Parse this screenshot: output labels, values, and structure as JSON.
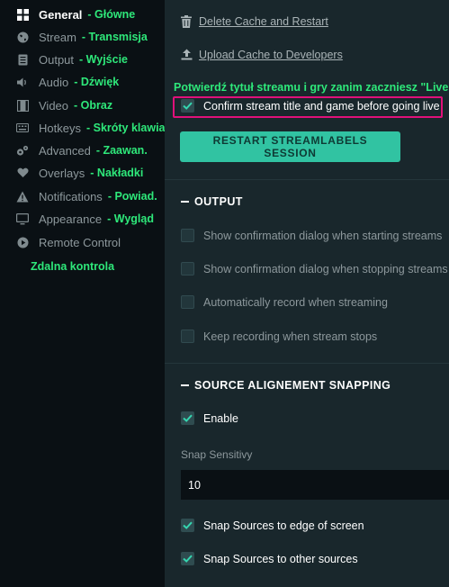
{
  "sidebar": {
    "items": [
      {
        "label": "General",
        "translation": "- Główne",
        "icon": "grid-icon",
        "active": true
      },
      {
        "label": "Stream",
        "translation": "- Transmisja",
        "icon": "globe-icon"
      },
      {
        "label": "Output",
        "translation": "- Wyjście",
        "icon": "file-icon"
      },
      {
        "label": "Audio",
        "translation": "- Dźwięk",
        "icon": "volume-icon"
      },
      {
        "label": "Video",
        "translation": "- Obraz",
        "icon": "film-icon"
      },
      {
        "label": "Hotkeys",
        "translation": "- Skróty klawiat",
        "icon": "keyboard-icon"
      },
      {
        "label": "Advanced",
        "translation": "- Zaawan.",
        "icon": "cogs-icon"
      },
      {
        "label": "Overlays",
        "translation": "- Nakładki",
        "icon": "heart-icon"
      },
      {
        "label": "Notifications",
        "translation": "- Powiad.",
        "icon": "warning-icon"
      },
      {
        "label": "Appearance",
        "translation": "- Wygląd",
        "icon": "monitor-icon"
      },
      {
        "label": "Remote Control",
        "translation": "",
        "icon": "play-circle-icon"
      }
    ],
    "remote_translation": "Zdalna kontrola"
  },
  "main": {
    "delete_cache_label": "Delete Cache and Restart",
    "upload_cache_label": "Upload Cache to Developers",
    "overlay_note": "Potwierdź tytuł streamu i gry zanim zaczniesz \"Live\"",
    "confirm_title_label": "Confirm stream title and game before going live",
    "restart_button_label": "RESTART STREAMLABELS SESSION",
    "output_section": {
      "title": "OUTPUT",
      "options": [
        {
          "label": "Show confirmation dialog when starting streams",
          "checked": false
        },
        {
          "label": "Show confirmation dialog when stopping streams",
          "checked": false
        },
        {
          "label": "Automatically record when streaming",
          "checked": false
        },
        {
          "label": "Keep recording when stream stops",
          "checked": false
        }
      ]
    },
    "snapping_section": {
      "title": "SOURCE ALIGNEMENT SNAPPING",
      "enable_label": "Enable",
      "sensitivity_label": "Snap Sensitivy",
      "sensitivity_value": "10",
      "edge_label": "Snap Sources to edge of screen",
      "other_label": "Snap Sources to other sources"
    }
  },
  "colors": {
    "accent": "#31c3a2",
    "translation_green": "#2ee87a",
    "highlight_pink": "#e0117a",
    "panel_bg": "#19272c",
    "sidebar_bg": "#0a1014"
  }
}
